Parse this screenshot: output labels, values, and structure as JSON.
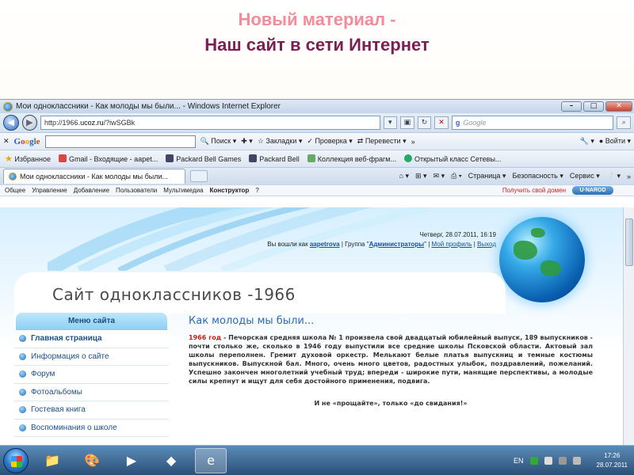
{
  "slide": {
    "title_line1": "Новый материал -",
    "title_line2": "Наш сайт в сети Интернет"
  },
  "browser": {
    "window_title": "Мои одноклассники - Как молоды мы были... - Windows Internet Explorer",
    "address_prefix": "http://1966.",
    "address_domain": "ucoz.ru",
    "address_suffix": "/?iwSGBk",
    "search_placeholder": "Google",
    "google_toolbar": {
      "logo": "Google",
      "search_btn": "Поиск",
      "bookmarks": "Закладки",
      "spellcheck": "Проверка",
      "translate": "Перевести",
      "more": "»",
      "signin": "Войти"
    },
    "favorites": {
      "label": "Избранное",
      "items": [
        "Gmail - Входящие - aapet...",
        "Packard Bell Games",
        "Packard Bell",
        "Коллекция веб-фрагм...",
        "Открытый класс  Сетевы..."
      ]
    },
    "tab_title": "Мои одноклассники - Как молоды мы были...",
    "command_bar": {
      "page": "Страница",
      "safety": "Безопасность",
      "tools": "Сервис"
    }
  },
  "ucoz_panel": {
    "items": [
      "Общее",
      "Управление",
      "Добавление",
      "Пользователи",
      "Мультимедиа",
      "Конструктор",
      "?"
    ],
    "domain_link": "Получить свой домен",
    "logo": "U·NAROD"
  },
  "site": {
    "datetime": "Четверг, 28.07.2011, 16:19",
    "login_prefix": "Вы вошли как",
    "username": "aapetrova",
    "group_prefix": "| Группа \"",
    "group": "Администраторы",
    "group_suffix": "\" |",
    "profile_link": "Мой профиль",
    "sep": "|",
    "logout_link": "Выход",
    "title": "Сайт одноклассников -1966",
    "menu_title": "Меню сайта",
    "menu_items": [
      "Главная страница",
      "Информация о сайте",
      "Форум",
      "Фотоальбомы",
      "Гостевая книга",
      "Воспоминания о школе"
    ],
    "heading": "Как молоды мы были...",
    "para_year": "1966 год",
    "para_text": " - Печорская средняя школа № 1 произвела свой двадцатый юбилейный выпуск, 189 выпускников - почти столько же, сколько в 1946 году выпустили все средние школы Псковской области. Актовый зал школы переполнен. Гремит духовой оркестр. Мелькают белые платья выпускниц и темные костюмы выпускников. Выпускной бал. Много, очень много цветов, радостных улыбок, поздравлений, пожеланий. Успешно закончен многолетний учебный труд; впереди - широкие пути, манящие перспективы, а молодые силы крепнут и ищут для себя достойного применения, подвига.",
    "closing": "И не «прощайте», только «до свидания!»"
  },
  "taskbar": {
    "lang": "EN",
    "time": "17:26",
    "date": "28.07.2011"
  },
  "colors": {
    "slide_title_pink": "#f28c9a",
    "slide_title_dark": "#7a1f52",
    "link_blue": "#1a4fa3",
    "year_red": "#c01f1f"
  }
}
